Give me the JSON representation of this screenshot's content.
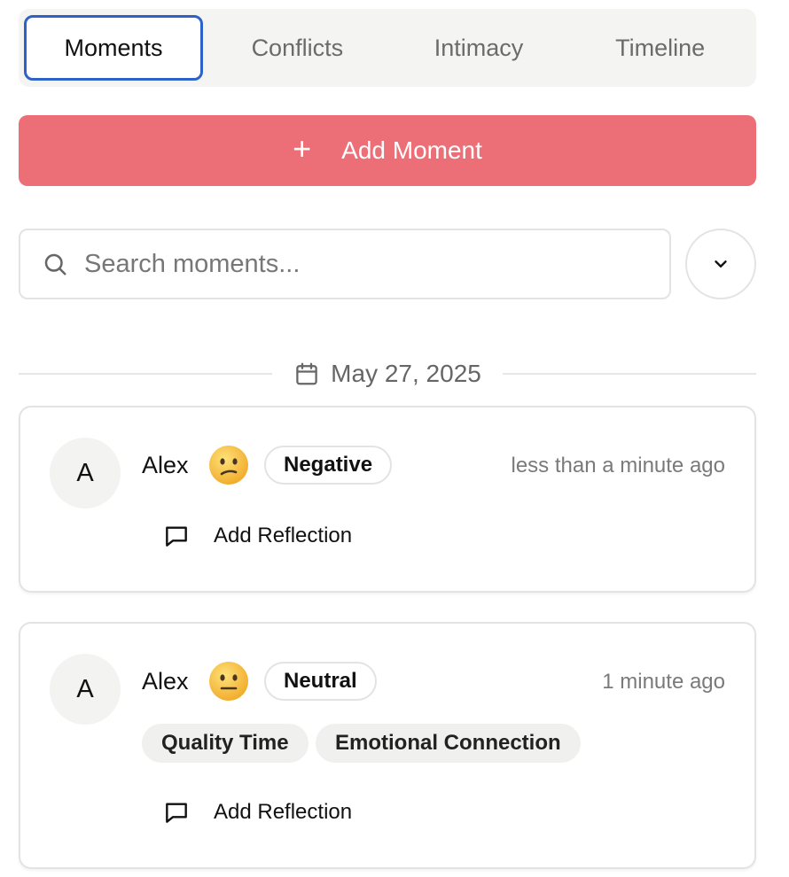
{
  "tabs": [
    {
      "label": "Moments",
      "active": true
    },
    {
      "label": "Conflicts",
      "active": false
    },
    {
      "label": "Intimacy",
      "active": false
    },
    {
      "label": "Timeline",
      "active": false
    }
  ],
  "add_button": {
    "label": "Add Moment",
    "icon": "plus-icon"
  },
  "search": {
    "placeholder": "Search moments...",
    "value": "",
    "icon": "search-icon"
  },
  "filter": {
    "icon": "chevron-down-icon"
  },
  "date_group": {
    "label": "May 27, 2025",
    "icon": "calendar-icon"
  },
  "moments": [
    {
      "avatar": "A",
      "name": "Alex",
      "emoji": "confused-face",
      "mood": "Negative",
      "time": "less than a minute ago",
      "tags": [],
      "reflection_label": "Add Reflection"
    },
    {
      "avatar": "A",
      "name": "Alex",
      "emoji": "neutral-face",
      "mood": "Neutral",
      "time": "1 minute ago",
      "tags": [
        "Quality Time",
        "Emotional Connection"
      ],
      "reflection_label": "Add Reflection"
    }
  ],
  "colors": {
    "accent": "#ec6f77",
    "active_tab_border": "#2d63c8"
  }
}
